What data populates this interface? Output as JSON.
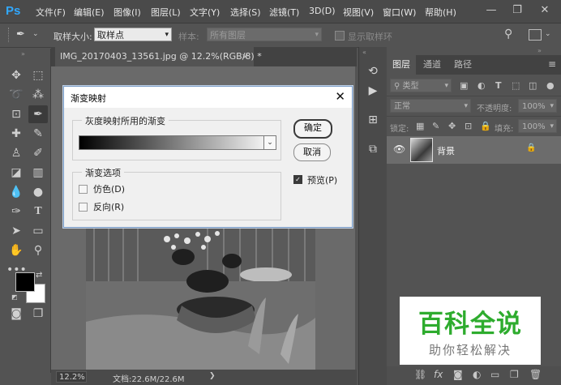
{
  "app": {
    "logo": "Ps",
    "menu": [
      "文件(F)",
      "编辑(E)",
      "图像(I)",
      "图层(L)",
      "文字(Y)",
      "选择(S)",
      "滤镜(T)",
      "3D(D)",
      "视图(V)",
      "窗口(W)",
      "帮助(H)"
    ],
    "window_controls": [
      "—",
      "❐",
      "✕"
    ]
  },
  "options_bar": {
    "sample_size_label": "取样大小:",
    "sample_size_value": "取样点",
    "sample_label": "样本:",
    "sample_value": "所有图层",
    "show_ring_label": "显示取样环"
  },
  "document": {
    "tab_title": "IMG_20170403_13561.jpg @ 12.2%(RGB/8) *",
    "tab_close": "×",
    "zoom": "12.2%",
    "doc_info": "文档:22.6M/22.6M",
    "status_arrow": "❯"
  },
  "dialog": {
    "title": "渐变映射",
    "close": "✕",
    "gradient_group_label": "灰度映射所用的渐变",
    "gradient_dropdown_arrow": "⌄",
    "options_group_label": "渐变选项",
    "dither_label": "仿色(D)",
    "reverse_label": "反向(R)",
    "ok_label": "确定",
    "cancel_label": "取消",
    "preview_label": "预览(P)",
    "preview_checked": true,
    "dither_checked": false,
    "reverse_checked": false
  },
  "layers_panel": {
    "tabs": [
      "图层",
      "通道",
      "路径"
    ],
    "active_tab": "图层",
    "filter_label": "类型",
    "blend_mode": "正常",
    "opacity_label": "不透明度:",
    "opacity_value": "100%",
    "lock_label": "锁定:",
    "fill_label": "填充:",
    "fill_value": "100%",
    "layer_name": "背景",
    "layer_locked": true
  },
  "watermark": {
    "title": "百科全说",
    "subtitle": "助你轻松解决"
  },
  "colors": {
    "ps_blue": "#31a8ff",
    "panel_bg": "#535353",
    "dialog_bg": "#f0f0f0",
    "watermark_green": "#2eac2e"
  }
}
